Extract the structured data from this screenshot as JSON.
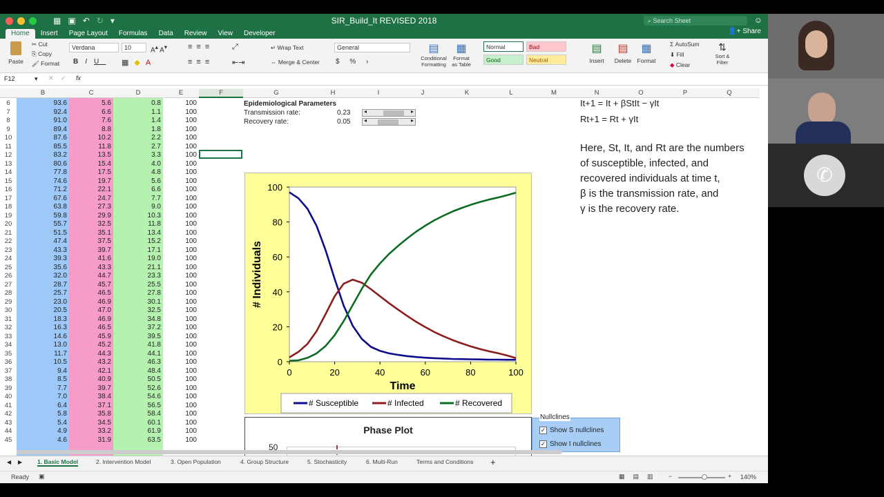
{
  "app": {
    "title": "SIR_Build_It REVISED 2018",
    "search_placeholder": "Search Sheet",
    "share": "Share",
    "tabs": [
      "Home",
      "Insert",
      "Page Layout",
      "Formulas",
      "Data",
      "Review",
      "View",
      "Developer"
    ]
  },
  "ribbon": {
    "paste": "Paste",
    "cut": "Cut",
    "copy": "Copy",
    "format": "Format",
    "font": "Verdana",
    "size": "10",
    "wrap_text": "Wrap Text",
    "merge_center": "Merge & Center",
    "number_format": "General",
    "conditional_formatting": "Conditional Formatting",
    "format_as_table": "Format as Table",
    "styles": {
      "normal": "Normal",
      "bad": "Bad",
      "good": "Good",
      "neutral": "Neutral"
    },
    "insert": "Insert",
    "delete": "Delete",
    "format_cells": "Format",
    "autosum": "AutoSum",
    "fill": "Fill",
    "clear": "Clear",
    "sort_filter": "Sort & Filter"
  },
  "formula_bar": {
    "name_box": "F12",
    "fx": "fx",
    "value": ""
  },
  "columns": [
    "B",
    "C",
    "D",
    "E",
    "F",
    "G",
    "H",
    "I",
    "J",
    "K",
    "L",
    "M",
    "N",
    "O",
    "P",
    "Q"
  ],
  "rows": [
    {
      "n": "6",
      "b": "93.6",
      "c": "5.6",
      "d": "0.8",
      "e": "100"
    },
    {
      "n": "7",
      "b": "92.4",
      "c": "6.6",
      "d": "1.1",
      "e": "100"
    },
    {
      "n": "8",
      "b": "91.0",
      "c": "7.6",
      "d": "1.4",
      "e": "100"
    },
    {
      "n": "9",
      "b": "89.4",
      "c": "8.8",
      "d": "1.8",
      "e": "100"
    },
    {
      "n": "10",
      "b": "87.6",
      "c": "10.2",
      "d": "2.2",
      "e": "100"
    },
    {
      "n": "11",
      "b": "85.5",
      "c": "11.8",
      "d": "2.7",
      "e": "100"
    },
    {
      "n": "12",
      "b": "83.2",
      "c": "13.5",
      "d": "3.3",
      "e": "100"
    },
    {
      "n": "13",
      "b": "80.6",
      "c": "15.4",
      "d": "4.0",
      "e": "100"
    },
    {
      "n": "14",
      "b": "77.8",
      "c": "17.5",
      "d": "4.8",
      "e": "100"
    },
    {
      "n": "15",
      "b": "74.6",
      "c": "19.7",
      "d": "5.6",
      "e": "100"
    },
    {
      "n": "16",
      "b": "71.2",
      "c": "22.1",
      "d": "6.6",
      "e": "100"
    },
    {
      "n": "17",
      "b": "67.6",
      "c": "24.7",
      "d": "7.7",
      "e": "100"
    },
    {
      "n": "18",
      "b": "63.8",
      "c": "27.3",
      "d": "9.0",
      "e": "100"
    },
    {
      "n": "19",
      "b": "59.8",
      "c": "29.9",
      "d": "10.3",
      "e": "100"
    },
    {
      "n": "20",
      "b": "55.7",
      "c": "32.5",
      "d": "11.8",
      "e": "100"
    },
    {
      "n": "21",
      "b": "51.5",
      "c": "35.1",
      "d": "13.4",
      "e": "100"
    },
    {
      "n": "22",
      "b": "47.4",
      "c": "37.5",
      "d": "15.2",
      "e": "100"
    },
    {
      "n": "23",
      "b": "43.3",
      "c": "39.7",
      "d": "17.1",
      "e": "100"
    },
    {
      "n": "24",
      "b": "39.3",
      "c": "41.6",
      "d": "19.0",
      "e": "100"
    },
    {
      "n": "25",
      "b": "35.6",
      "c": "43.3",
      "d": "21.1",
      "e": "100"
    },
    {
      "n": "26",
      "b": "32.0",
      "c": "44.7",
      "d": "23.3",
      "e": "100"
    },
    {
      "n": "27",
      "b": "28.7",
      "c": "45.7",
      "d": "25.5",
      "e": "100"
    },
    {
      "n": "28",
      "b": "25.7",
      "c": "46.5",
      "d": "27.8",
      "e": "100"
    },
    {
      "n": "29",
      "b": "23.0",
      "c": "46.9",
      "d": "30.1",
      "e": "100"
    },
    {
      "n": "30",
      "b": "20.5",
      "c": "47.0",
      "d": "32.5",
      "e": "100"
    },
    {
      "n": "31",
      "b": "18.3",
      "c": "46.9",
      "d": "34.8",
      "e": "100"
    },
    {
      "n": "32",
      "b": "16.3",
      "c": "46.5",
      "d": "37.2",
      "e": "100"
    },
    {
      "n": "33",
      "b": "14.6",
      "c": "45.9",
      "d": "39.5",
      "e": "100"
    },
    {
      "n": "34",
      "b": "13.0",
      "c": "45.2",
      "d": "41.8",
      "e": "100"
    },
    {
      "n": "35",
      "b": "11.7",
      "c": "44.3",
      "d": "44.1",
      "e": "100"
    },
    {
      "n": "36",
      "b": "10.5",
      "c": "43.2",
      "d": "46.3",
      "e": "100"
    },
    {
      "n": "37",
      "b": "9.4",
      "c": "42.1",
      "d": "48.4",
      "e": "100"
    },
    {
      "n": "38",
      "b": "8.5",
      "c": "40.9",
      "d": "50.5",
      "e": "100"
    },
    {
      "n": "39",
      "b": "7.7",
      "c": "39.7",
      "d": "52.6",
      "e": "100"
    },
    {
      "n": "40",
      "b": "7.0",
      "c": "38.4",
      "d": "54.6",
      "e": "100"
    },
    {
      "n": "41",
      "b": "6.4",
      "c": "37.1",
      "d": "56.5",
      "e": "100"
    },
    {
      "n": "42",
      "b": "5.8",
      "c": "35.8",
      "d": "58.4",
      "e": "100"
    },
    {
      "n": "43",
      "b": "5.4",
      "c": "34.5",
      "d": "60.1",
      "e": "100"
    },
    {
      "n": "44",
      "b": "4.9",
      "c": "33.2",
      "d": "61.9",
      "e": "100"
    },
    {
      "n": "45",
      "b": "4.6",
      "c": "31.9",
      "d": "63.5",
      "e": "100"
    }
  ],
  "params": {
    "heading": "Epidemiological Parameters",
    "transmission_label": "Transmission rate:",
    "transmission_value": "0.23",
    "recovery_label": "Recovery rate:",
    "recovery_value": "0.05"
  },
  "equations": {
    "line1": "It+1 = It + βStIt − γIt",
    "line2": "Rt+1 = Rt + γIt",
    "p1": "Here, St, It, and Rt are the numbers",
    "p2": "of susceptible, infected, and",
    "p3": "recovered individuals at time t,",
    "p4": "β is the transmission rate, and",
    "p5": "γ is the recovery rate."
  },
  "nullclines": {
    "title": "Nullclines",
    "s_label": "Show S nullclines",
    "i_label": "Show I nullclines",
    "s_checked": true,
    "i_checked": true
  },
  "phase_plot": {
    "title": "Phase Plot",
    "y_top_tick": "50"
  },
  "chart_data": {
    "type": "line",
    "title": "",
    "xlabel": "Time",
    "ylabel": "# Individuals",
    "xlim": [
      0,
      100
    ],
    "ylim": [
      0,
      100
    ],
    "xticks": [
      0,
      20,
      40,
      60,
      80,
      100
    ],
    "yticks": [
      0,
      20,
      40,
      60,
      80,
      100
    ],
    "x": [
      0,
      4,
      8,
      12,
      16,
      20,
      24,
      28,
      32,
      36,
      40,
      44,
      48,
      52,
      56,
      60,
      64,
      68,
      72,
      76,
      80,
      84,
      88,
      92,
      96,
      100
    ],
    "series": [
      {
        "name": "# Susceptible",
        "color": "#0b0b8c",
        "values": [
          97,
          93.6,
          87.6,
          77.8,
          63.8,
          47.4,
          32,
          20.5,
          13,
          8.5,
          6.2,
          4.8,
          3.9,
          3.2,
          2.7,
          2.3,
          2,
          1.8,
          1.6,
          1.5,
          1.4,
          1.3,
          1.2,
          1.2,
          1.1,
          1.1
        ]
      },
      {
        "name": "# Infected",
        "color": "#8c1c1c",
        "values": [
          2.5,
          5.6,
          10.2,
          17.5,
          27.3,
          37.5,
          44.7,
          47,
          45.2,
          41.5,
          37.5,
          33.5,
          29.8,
          26.2,
          22.8,
          19.8,
          17,
          14.6,
          12.4,
          10.5,
          8.8,
          7.3,
          6,
          4.9,
          3.6,
          2.1
        ]
      },
      {
        "name": "# Recovered",
        "color": "#0b6b1f",
        "values": [
          0.5,
          0.8,
          2.2,
          4.8,
          9,
          15.2,
          23.3,
          32.5,
          41.8,
          50,
          56.3,
          61.7,
          66.3,
          70.6,
          74.5,
          77.9,
          81,
          83.6,
          86,
          88,
          89.8,
          91.4,
          92.8,
          94,
          95.3,
          96.8
        ]
      }
    ],
    "legend": "bottom"
  },
  "sheet_tabs": [
    "1. Basic Model",
    "2. Intervention Model",
    "3. Open Population",
    "4. Group Structure",
    "5. Stochasticity",
    "6. Multi-Run",
    "Terms and Conditions"
  ],
  "status": {
    "ready": "Ready",
    "zoom": "140%"
  },
  "colors": {
    "excel_green": "#1e7145",
    "col_b": "#9dc8f7",
    "col_c": "#f59dc8",
    "col_d": "#b5f2b0",
    "chart_bg": "#ffff99"
  }
}
